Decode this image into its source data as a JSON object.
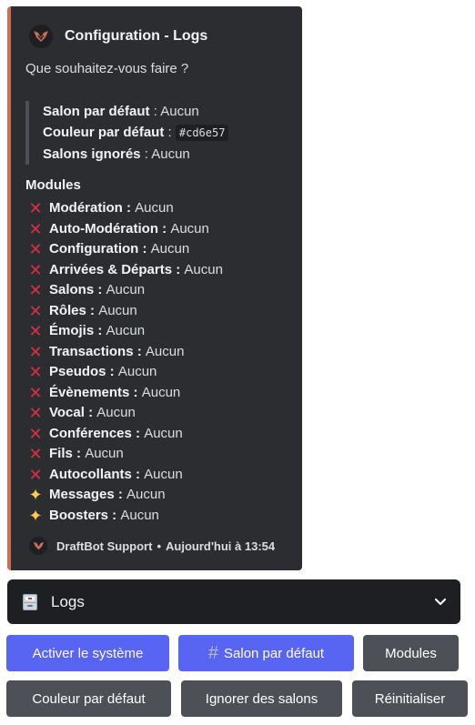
{
  "embed": {
    "accent_color": "#cd6e57",
    "title": "Configuration - Logs",
    "description": "Que souhaitez-vous faire ?",
    "defaults": [
      {
        "label": "Salon par défaut",
        "sep": " : ",
        "value": "Aucun"
      },
      {
        "label": "Couleur par défaut",
        "sep": " : ",
        "value": "#cd6e57"
      },
      {
        "label": "Salons ignorés",
        "sep": " : ",
        "value": "Aucun"
      }
    ],
    "modules_heading": "Modules",
    "modules": [
      {
        "icon": "cross-mark-icon",
        "label": "Modération :",
        "value": "Aucun"
      },
      {
        "icon": "cross-mark-icon",
        "label": "Auto-Modération :",
        "value": "Aucun"
      },
      {
        "icon": "cross-mark-icon",
        "label": "Configuration :",
        "value": "Aucun"
      },
      {
        "icon": "cross-mark-icon",
        "label": "Arrivées & Départs :",
        "value": "Aucun"
      },
      {
        "icon": "cross-mark-icon",
        "label": "Salons :",
        "value": "Aucun"
      },
      {
        "icon": "cross-mark-icon",
        "label": "Rôles :",
        "value": "Aucun"
      },
      {
        "icon": "cross-mark-icon",
        "label": "Émojis :",
        "value": "Aucun"
      },
      {
        "icon": "cross-mark-icon",
        "label": "Transactions :",
        "value": "Aucun"
      },
      {
        "icon": "cross-mark-icon",
        "label": "Pseudos :",
        "value": "Aucun"
      },
      {
        "icon": "cross-mark-icon",
        "label": "Évènements :",
        "value": "Aucun"
      },
      {
        "icon": "cross-mark-icon",
        "label": "Vocal :",
        "value": "Aucun"
      },
      {
        "icon": "cross-mark-icon",
        "label": "Conférences :",
        "value": "Aucun"
      },
      {
        "icon": "cross-mark-icon",
        "label": "Fils :",
        "value": "Aucun"
      },
      {
        "icon": "cross-mark-icon",
        "label": "Autocollants :",
        "value": "Aucun"
      },
      {
        "icon": "sparkles-icon",
        "label": "Messages :",
        "value": "Aucun"
      },
      {
        "icon": "sparkles-icon",
        "label": "Boosters :",
        "value": "Aucun"
      }
    ],
    "footer": {
      "author": "DraftBot Support",
      "bullet": "•",
      "timestamp": "Aujourd'hui à 13:54"
    }
  },
  "select": {
    "icon": "file-cabinet-icon",
    "label": "Logs"
  },
  "buttons": {
    "enable": "Activer le système",
    "channel_hash": "#",
    "channel": "Salon par défaut",
    "modules": "Modules",
    "color": "Couleur par défaut",
    "ignore": "Ignorer des salons",
    "reset": "Réinitialiser"
  },
  "colors": {
    "blurple": "#5865f2",
    "grey": "#4e5058",
    "embed_bg": "#2b2d31"
  }
}
